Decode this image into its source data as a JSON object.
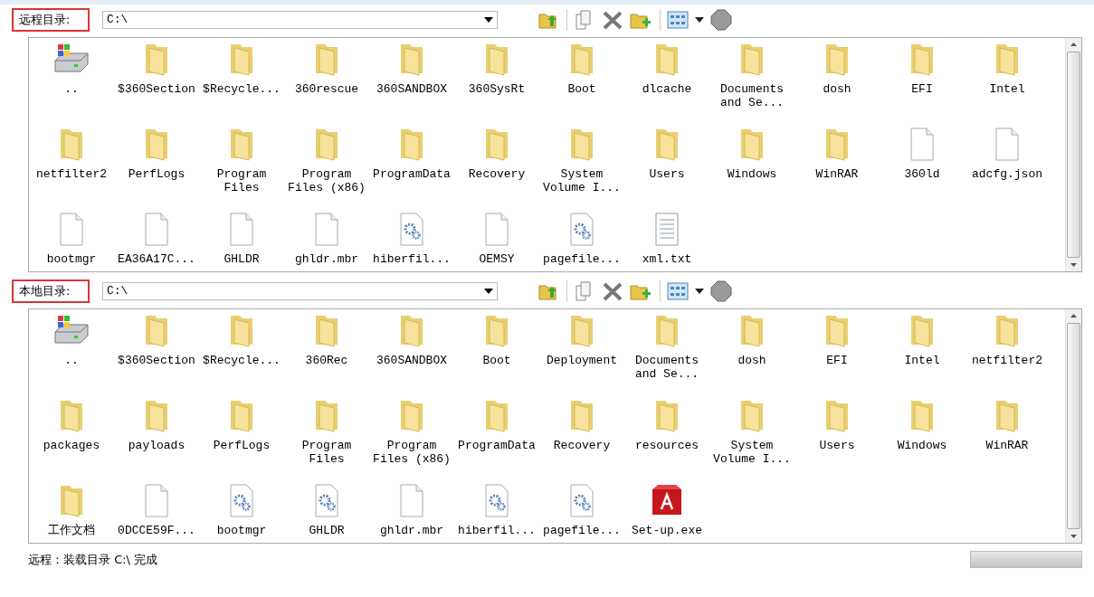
{
  "panels": [
    {
      "label": "远程目录:",
      "path": "C:\\",
      "items": [
        {
          "name": "..",
          "kind": "drive"
        },
        {
          "name": "$360Section",
          "kind": "folder"
        },
        {
          "name": "$Recycle...",
          "kind": "folder"
        },
        {
          "name": "360rescue",
          "kind": "folder"
        },
        {
          "name": "360SANDBOX",
          "kind": "folder"
        },
        {
          "name": "360SysRt",
          "kind": "folder"
        },
        {
          "name": "Boot",
          "kind": "folder"
        },
        {
          "name": "dlcache",
          "kind": "folder"
        },
        {
          "name": "Documents and Se...",
          "kind": "folder"
        },
        {
          "name": "dosh",
          "kind": "folder"
        },
        {
          "name": "EFI",
          "kind": "folder"
        },
        {
          "name": "Intel",
          "kind": "folder"
        },
        {
          "name": "netfilter2",
          "kind": "folder"
        },
        {
          "name": "PerfLogs",
          "kind": "folder"
        },
        {
          "name": "Program Files",
          "kind": "folder"
        },
        {
          "name": "Program Files (x86)",
          "kind": "folder"
        },
        {
          "name": "ProgramData",
          "kind": "folder"
        },
        {
          "name": "Recovery",
          "kind": "folder"
        },
        {
          "name": "System Volume I...",
          "kind": "folder"
        },
        {
          "name": "Users",
          "kind": "folder"
        },
        {
          "name": "Windows",
          "kind": "folder"
        },
        {
          "name": "WinRAR",
          "kind": "folder"
        },
        {
          "name": "360ld",
          "kind": "file"
        },
        {
          "name": "adcfg.json",
          "kind": "file"
        },
        {
          "name": "bootmgr",
          "kind": "file"
        },
        {
          "name": "EA36A17C...",
          "kind": "file"
        },
        {
          "name": "GHLDR",
          "kind": "file"
        },
        {
          "name": "ghldr.mbr",
          "kind": "file"
        },
        {
          "name": "hiberfil...",
          "kind": "system"
        },
        {
          "name": "OEMSY",
          "kind": "file"
        },
        {
          "name": "pagefile...",
          "kind": "system"
        },
        {
          "name": "xml.txt",
          "kind": "text"
        }
      ]
    },
    {
      "label": "本地目录:",
      "path": "C:\\",
      "items": [
        {
          "name": "..",
          "kind": "drive"
        },
        {
          "name": "$360Section",
          "kind": "folder"
        },
        {
          "name": "$Recycle...",
          "kind": "folder"
        },
        {
          "name": "360Rec",
          "kind": "folder"
        },
        {
          "name": "360SANDBOX",
          "kind": "folder"
        },
        {
          "name": "Boot",
          "kind": "folder"
        },
        {
          "name": "Deployment",
          "kind": "folder"
        },
        {
          "name": "Documents and Se...",
          "kind": "folder"
        },
        {
          "name": "dosh",
          "kind": "folder"
        },
        {
          "name": "EFI",
          "kind": "folder"
        },
        {
          "name": "Intel",
          "kind": "folder"
        },
        {
          "name": "netfilter2",
          "kind": "folder"
        },
        {
          "name": "packages",
          "kind": "folder"
        },
        {
          "name": "payloads",
          "kind": "folder"
        },
        {
          "name": "PerfLogs",
          "kind": "folder"
        },
        {
          "name": "Program Files",
          "kind": "folder"
        },
        {
          "name": "Program Files (x86)",
          "kind": "folder"
        },
        {
          "name": "ProgramData",
          "kind": "folder"
        },
        {
          "name": "Recovery",
          "kind": "folder"
        },
        {
          "name": "resources",
          "kind": "folder"
        },
        {
          "name": "System Volume I...",
          "kind": "folder"
        },
        {
          "name": "Users",
          "kind": "folder"
        },
        {
          "name": "Windows",
          "kind": "folder"
        },
        {
          "name": "WinRAR",
          "kind": "folder"
        },
        {
          "name": "工作文档",
          "kind": "folder"
        },
        {
          "name": "0DCCE59F...",
          "kind": "file"
        },
        {
          "name": "bootmgr",
          "kind": "system"
        },
        {
          "name": "GHLDR",
          "kind": "system"
        },
        {
          "name": "ghldr.mbr",
          "kind": "file"
        },
        {
          "name": "hiberfil...",
          "kind": "system"
        },
        {
          "name": "pagefile...",
          "kind": "system"
        },
        {
          "name": "Set-up.exe",
          "kind": "installer"
        }
      ]
    }
  ],
  "status": "远程：装载目录 C:\\ 完成",
  "progress": {
    "level": 1
  }
}
